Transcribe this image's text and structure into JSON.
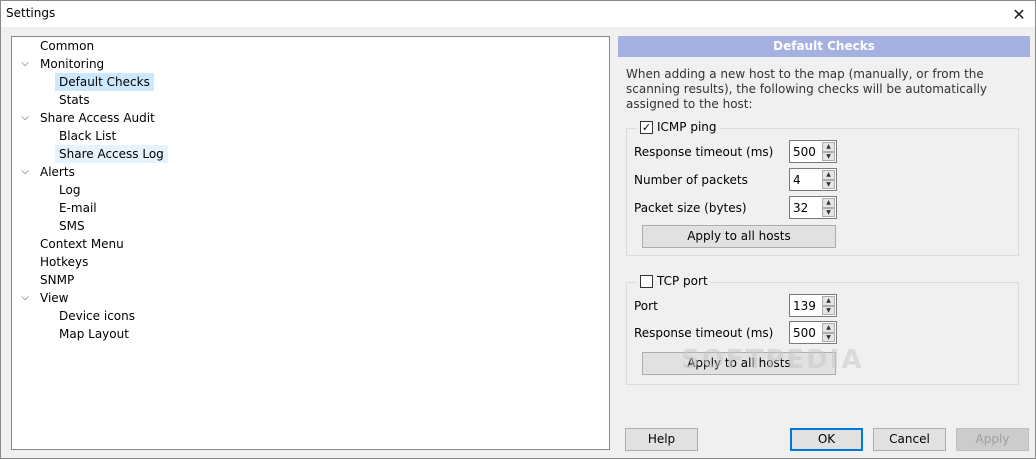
{
  "window": {
    "title": "Settings",
    "close_symbol": "✕"
  },
  "tree": {
    "items": [
      {
        "label": "Common"
      },
      {
        "label": "Monitoring",
        "expander": "⌵"
      },
      {
        "label": "Default Checks"
      },
      {
        "label": "Stats"
      },
      {
        "label": "Share Access Audit",
        "expander": "⌵"
      },
      {
        "label": "Black List"
      },
      {
        "label": "Share Access Log"
      },
      {
        "label": "Alerts",
        "expander": "⌵"
      },
      {
        "label": "Log"
      },
      {
        "label": "E-mail"
      },
      {
        "label": "SMS"
      },
      {
        "label": "Context Menu"
      },
      {
        "label": "Hotkeys"
      },
      {
        "label": "SNMP"
      },
      {
        "label": "View",
        "expander": "⌵"
      },
      {
        "label": "Device icons"
      },
      {
        "label": "Map Layout"
      }
    ]
  },
  "panel": {
    "header": "Default Checks",
    "description": "When adding a new host to the map (manually, or from the scanning results), the following checks will be automatically assigned to the host:"
  },
  "icmp": {
    "label": "ICMP ping",
    "checked": "✓",
    "timeout_label": "Response timeout (ms)",
    "timeout_value": "500",
    "packets_label": "Number of packets",
    "packets_value": "4",
    "size_label": "Packet size (bytes)",
    "size_value": "32",
    "apply_label": "Apply to all hosts"
  },
  "tcp": {
    "label": "TCP port",
    "port_label": "Port",
    "port_value": "139",
    "timeout_label": "Response timeout (ms)",
    "timeout_value": "500",
    "apply_label": "Apply to all hosts"
  },
  "spin_arrows": {
    "up": "▲",
    "down": "▼"
  },
  "footer": {
    "help": "Help",
    "ok": "OK",
    "cancel": "Cancel",
    "apply": "Apply"
  },
  "watermark": "SOFTPEDIA",
  "colors": {
    "header_bg": "#a6b1e1",
    "selection": "#cce8ff",
    "default_button_border": "#0078d7"
  }
}
